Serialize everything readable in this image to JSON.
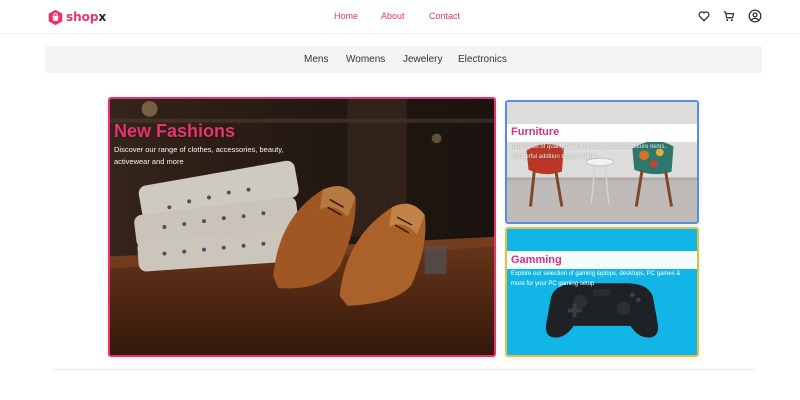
{
  "brand": {
    "name_main": "shop",
    "name_x": "x",
    "accent": "#e8336f"
  },
  "nav": {
    "home": "Home",
    "about": "About",
    "contact": "Contact"
  },
  "header_icons": [
    "heart-icon",
    "cart-icon",
    "user-icon"
  ],
  "categories": [
    "Mens",
    "Womens",
    "Jewelery",
    "Electronics"
  ],
  "hero": {
    "title": "New Fashions",
    "description": "Discover our range of clothes, accessories, beauty, activewear and more",
    "border_color": "#e8336f"
  },
  "furniture": {
    "title": "Furniture",
    "description": "thousands of quality new and second hand furniture items, wonderful addition to your home",
    "border_color": "#5a8de0"
  },
  "gaming": {
    "title": "Gamming",
    "description": "Explore our selection of gaming laptops, desktops, PC games & more for your PC gaming setup",
    "border_color": "#e1c23a"
  }
}
